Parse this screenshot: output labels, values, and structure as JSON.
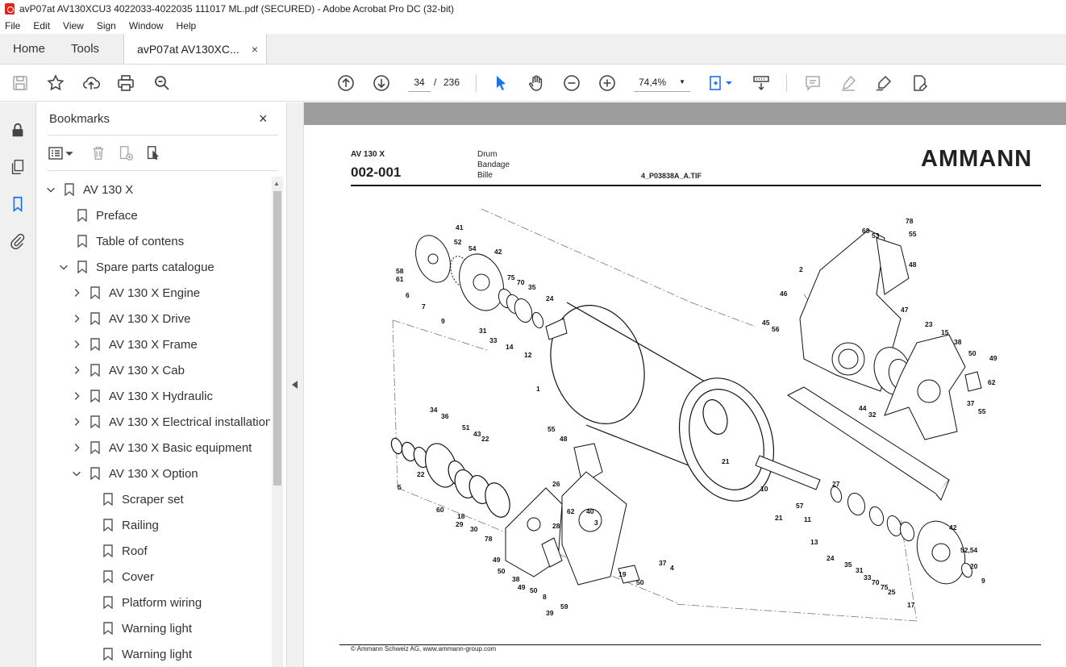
{
  "window": {
    "title": "avP07at AV130XCU3 4022033-4022035 111017 ML.pdf (SECURED) - Adobe Acrobat Pro DC (32-bit)"
  },
  "menu": [
    "File",
    "Edit",
    "View",
    "Sign",
    "Window",
    "Help"
  ],
  "tabs": {
    "home": "Home",
    "tools": "Tools",
    "document": "avP07at AV130XC...",
    "close": "×"
  },
  "toolbar": {
    "page_current": "34",
    "page_separator": "/",
    "page_total": "236",
    "zoom": "74,4%"
  },
  "bookmarks": {
    "title": "Bookmarks",
    "close": "×",
    "items": [
      {
        "label": "AV 130 X",
        "level": 0,
        "state": "expanded"
      },
      {
        "label": "Preface",
        "level": 1,
        "state": "leaf"
      },
      {
        "label": "Table of contens",
        "level": 1,
        "state": "leaf"
      },
      {
        "label": "Spare parts catalogue",
        "level": 1,
        "state": "expanded"
      },
      {
        "label": "AV 130 X Engine",
        "level": 2,
        "state": "collapsed"
      },
      {
        "label": "AV 130 X Drive",
        "level": 2,
        "state": "collapsed"
      },
      {
        "label": "AV 130 X Frame",
        "level": 2,
        "state": "collapsed"
      },
      {
        "label": "AV 130 X Cab",
        "level": 2,
        "state": "collapsed"
      },
      {
        "label": "AV 130 X Hydraulic",
        "level": 2,
        "state": "collapsed"
      },
      {
        "label": "AV 130 X Electrical installation",
        "level": 2,
        "state": "collapsed"
      },
      {
        "label": "AV 130 X Basic equipment",
        "level": 2,
        "state": "collapsed"
      },
      {
        "label": "AV 130 X Option",
        "level": 2,
        "state": "expanded"
      },
      {
        "label": "Scraper set",
        "level": 3,
        "state": "leaf"
      },
      {
        "label": "Railing",
        "level": 3,
        "state": "leaf"
      },
      {
        "label": "Roof",
        "level": 3,
        "state": "leaf"
      },
      {
        "label": "Cover",
        "level": 3,
        "state": "leaf"
      },
      {
        "label": "Platform wiring",
        "level": 3,
        "state": "leaf"
      },
      {
        "label": "Warning light",
        "level": 3,
        "state": "leaf"
      },
      {
        "label": "Warning light",
        "level": 3,
        "state": "leaf"
      }
    ]
  },
  "page": {
    "model": "AV 130 X",
    "number": "002-001",
    "desc_en": "Drum",
    "desc_de": "Bandage",
    "desc_fr": "Bille",
    "file": "4_P03838A_A.TIF",
    "logo": "AMMANN",
    "footer": "© Ammann Schweiz AG, www.ammann-group.com"
  },
  "drawing": {
    "callouts": [
      "41",
      "52",
      "54",
      "42",
      "58",
      "61",
      "6",
      "7",
      "9",
      "75",
      "70",
      "35",
      "24",
      "31",
      "33",
      "14",
      "12",
      "1",
      "68",
      "53",
      "78",
      "55",
      "2",
      "48",
      "46",
      "47",
      "45",
      "56",
      "23",
      "15",
      "38",
      "50",
      "49",
      "62",
      "37",
      "55",
      "44",
      "32",
      "34",
      "36",
      "51",
      "43",
      "22",
      "5",
      "22",
      "60",
      "18",
      "29",
      "30",
      "78",
      "55",
      "48",
      "26",
      "62",
      "28",
      "40",
      "3",
      "49",
      "50",
      "38",
      "49",
      "50",
      "8",
      "39",
      "59",
      "19",
      "50",
      "37",
      "4",
      "27",
      "21",
      "10",
      "21",
      "57",
      "11",
      "13",
      "24",
      "35",
      "31",
      "33",
      "70",
      "75",
      "25",
      "42",
      "52,54",
      "20",
      "9",
      "17"
    ]
  },
  "colors": {
    "accent": "#1a73e8",
    "pdf_red": "#e1251b",
    "doc_gray": "#9d9d9d"
  }
}
